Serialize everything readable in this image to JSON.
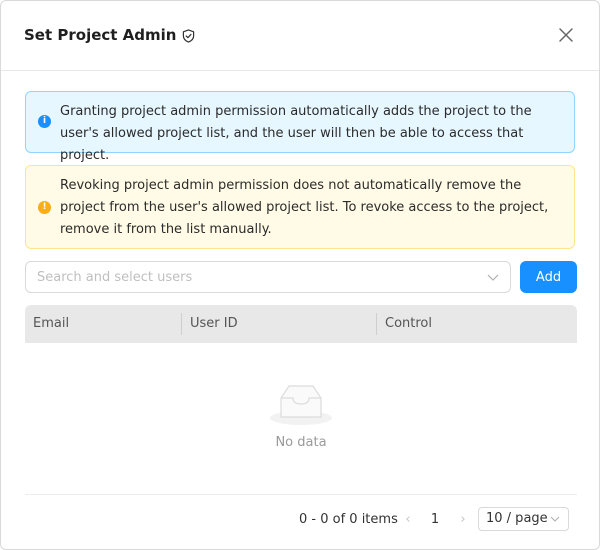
{
  "dialog": {
    "title": "Set Project Admin",
    "title_icon": "shield-check-icon",
    "close_icon": "close-icon"
  },
  "alerts": {
    "info": {
      "icon": "info-icon",
      "icon_glyph": "i",
      "text": "Granting project admin permission automatically adds the project to the user's allowed project list, and the user will then be able to access that project."
    },
    "warning": {
      "icon": "warning-icon",
      "icon_glyph": "!",
      "text": "Revoking project admin permission does not automatically remove the project from the user's allowed project list. To revoke access to the project, remove it from the list manually."
    }
  },
  "user_select": {
    "placeholder": "Search and select users",
    "value": ""
  },
  "add_button": {
    "label": "Add"
  },
  "table": {
    "columns": [
      "Email",
      "User ID",
      "Control"
    ],
    "rows": [],
    "empty_text": "No data"
  },
  "pagination": {
    "total_text": "0 - 0 of 0 items",
    "prev": "‹",
    "next": "›",
    "current_page": "1",
    "page_size": "10 / page"
  },
  "colors": {
    "primary": "#1890ff",
    "info_bg": "#e6f7ff",
    "warning_bg": "#fffbe6",
    "warning_icon": "#faad14"
  }
}
